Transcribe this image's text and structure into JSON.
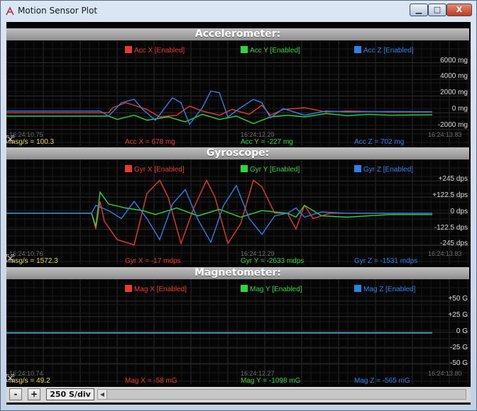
{
  "window": {
    "title": "Motion Sensor Plot",
    "min_label": "▁",
    "max_label": "□",
    "close_label": "X"
  },
  "panels": [
    {
      "key": "acc",
      "title": "Accelerometer:",
      "legend": [
        {
          "label": "Acc X [Enabled]",
          "color": "#e53a2e"
        },
        {
          "label": "Acc Y [Enabled]",
          "color": "#2bd63f"
        },
        {
          "label": "Acc Z [Enabled]",
          "color": "#2f7fe6"
        }
      ],
      "y_ticks": [
        "6000 mg",
        "4000 mg",
        "2000 mg",
        "0 mg",
        "-2000 mg"
      ],
      "y_tick_values": [
        6000,
        4000,
        2000,
        0,
        -2000
      ],
      "y_range": [
        -2200,
        6800
      ],
      "timestamps": [
        "16:24:10.75",
        "16:24:12.29",
        "16:24:13.83"
      ],
      "rate": "msg/s = 100.3",
      "readouts": [
        "Acc X = 678 mg",
        "Acc Y = -227 mg",
        "Acc Z = 702 mg"
      ],
      "series": [
        {
          "name": "Acc X",
          "color": "#e53a2e",
          "points": [
            [
              0,
              0
            ],
            [
              0.24,
              0
            ],
            [
              0.25,
              600
            ],
            [
              0.28,
              1200
            ],
            [
              0.3,
              900
            ],
            [
              0.33,
              400
            ],
            [
              0.36,
              -500
            ],
            [
              0.4,
              -300
            ],
            [
              0.43,
              800
            ],
            [
              0.46,
              200
            ],
            [
              0.5,
              -300
            ],
            [
              0.53,
              400
            ],
            [
              0.57,
              -200
            ],
            [
              0.6,
              900
            ],
            [
              0.62,
              -300
            ],
            [
              0.65,
              400
            ],
            [
              0.7,
              600
            ],
            [
              0.75,
              100
            ],
            [
              0.8,
              200
            ],
            [
              0.85,
              150
            ],
            [
              0.9,
              100
            ],
            [
              1,
              80
            ]
          ]
        },
        {
          "name": "Acc Y",
          "color": "#2bd63f",
          "points": [
            [
              0,
              -400
            ],
            [
              0.24,
              -400
            ],
            [
              0.26,
              -800
            ],
            [
              0.3,
              -300
            ],
            [
              0.33,
              -900
            ],
            [
              0.38,
              -500
            ],
            [
              0.42,
              -1100
            ],
            [
              0.46,
              -200
            ],
            [
              0.5,
              -800
            ],
            [
              0.54,
              -400
            ],
            [
              0.58,
              -1300
            ],
            [
              0.62,
              -500
            ],
            [
              0.66,
              -300
            ],
            [
              0.7,
              -500
            ],
            [
              0.75,
              -100
            ],
            [
              0.8,
              -350
            ],
            [
              0.85,
              -200
            ],
            [
              0.9,
              -300
            ],
            [
              1,
              -250
            ]
          ]
        },
        {
          "name": "Acc Z",
          "color": "#2f7fe6",
          "points": [
            [
              0,
              200
            ],
            [
              0.22,
              200
            ],
            [
              0.24,
              -400
            ],
            [
              0.27,
              1200
            ],
            [
              0.3,
              1600
            ],
            [
              0.32,
              400
            ],
            [
              0.35,
              -900
            ],
            [
              0.39,
              1800
            ],
            [
              0.41,
              1200
            ],
            [
              0.43,
              -1400
            ],
            [
              0.46,
              600
            ],
            [
              0.48,
              2600
            ],
            [
              0.5,
              2400
            ],
            [
              0.52,
              -500
            ],
            [
              0.55,
              600
            ],
            [
              0.58,
              1600
            ],
            [
              0.6,
              1200
            ],
            [
              0.62,
              -600
            ],
            [
              0.65,
              500
            ],
            [
              0.7,
              -300
            ],
            [
              0.75,
              200
            ],
            [
              0.8,
              100
            ],
            [
              0.9,
              150
            ],
            [
              1,
              120
            ]
          ]
        }
      ]
    },
    {
      "key": "gyr",
      "title": "Gyroscope:",
      "legend": [
        {
          "label": "Gyr X [Enabled]",
          "color": "#e53a2e"
        },
        {
          "label": "Gyr Y [Enabled]",
          "color": "#2bd63f"
        },
        {
          "label": "Gyr Z [Enabled]",
          "color": "#2f7fe6"
        }
      ],
      "y_ticks": [
        "+245 dps",
        "+122.5 dps",
        "0 dps",
        "-122.5 dps",
        "-245 dps"
      ],
      "y_tick_values": [
        245,
        122.5,
        0,
        -122.5,
        -245
      ],
      "y_range": [
        -280,
        290
      ],
      "timestamps": [
        "16:24:10.76",
        "16:24:12.29",
        "16:24:13.83"
      ],
      "rate": "msg/s = 1572.3",
      "readouts": [
        "Gyr X = -17 mdps",
        "Gyr Y = -2633 mdps",
        "Gyr Z = -1531 mdps"
      ],
      "series": [
        {
          "name": "Gyr X",
          "color": "#e53a2e",
          "points": [
            [
              0,
              0
            ],
            [
              0.2,
              0
            ],
            [
              0.21,
              -120
            ],
            [
              0.22,
              90
            ],
            [
              0.23,
              -60
            ],
            [
              0.26,
              -200
            ],
            [
              0.3,
              -240
            ],
            [
              0.33,
              150
            ],
            [
              0.36,
              250
            ],
            [
              0.38,
              120
            ],
            [
              0.41,
              -230
            ],
            [
              0.44,
              40
            ],
            [
              0.47,
              250
            ],
            [
              0.49,
              120
            ],
            [
              0.52,
              -230
            ],
            [
              0.55,
              -80
            ],
            [
              0.58,
              250
            ],
            [
              0.6,
              200
            ],
            [
              0.63,
              0
            ],
            [
              0.66,
              0
            ],
            [
              0.68,
              -120
            ],
            [
              0.7,
              60
            ],
            [
              0.72,
              -40
            ],
            [
              0.76,
              0
            ],
            [
              1,
              0
            ]
          ]
        },
        {
          "name": "Gyr Y",
          "color": "#2bd63f",
          "points": [
            [
              0,
              0
            ],
            [
              0.2,
              0
            ],
            [
              0.21,
              -100
            ],
            [
              0.22,
              160
            ],
            [
              0.24,
              70
            ],
            [
              0.28,
              40
            ],
            [
              0.32,
              20
            ],
            [
              0.35,
              -10
            ],
            [
              0.4,
              40
            ],
            [
              0.45,
              -20
            ],
            [
              0.5,
              30
            ],
            [
              0.55,
              -30
            ],
            [
              0.6,
              20
            ],
            [
              0.66,
              0
            ],
            [
              0.68,
              -30
            ],
            [
              0.7,
              60
            ],
            [
              0.74,
              -20
            ],
            [
              0.8,
              -30
            ],
            [
              0.85,
              -20
            ],
            [
              0.9,
              -10
            ],
            [
              1,
              -10
            ]
          ]
        },
        {
          "name": "Gyr Z",
          "color": "#2f7fe6",
          "points": [
            [
              0,
              0
            ],
            [
              0.2,
              0
            ],
            [
              0.21,
              60
            ],
            [
              0.24,
              20
            ],
            [
              0.27,
              -40
            ],
            [
              0.3,
              90
            ],
            [
              0.33,
              -40
            ],
            [
              0.36,
              -200
            ],
            [
              0.39,
              70
            ],
            [
              0.42,
              180
            ],
            [
              0.45,
              -50
            ],
            [
              0.48,
              -220
            ],
            [
              0.51,
              60
            ],
            [
              0.54,
              210
            ],
            [
              0.57,
              -40
            ],
            [
              0.6,
              -160
            ],
            [
              0.63,
              -20
            ],
            [
              0.66,
              0
            ],
            [
              0.68,
              40
            ],
            [
              0.7,
              -30
            ],
            [
              0.74,
              10
            ],
            [
              0.8,
              0
            ],
            [
              1,
              0
            ]
          ]
        }
      ]
    },
    {
      "key": "mag",
      "title": "Magnetometer:",
      "legend": [
        {
          "label": "Mag X [Enabled]",
          "color": "#e53a2e"
        },
        {
          "label": "Mag Y [Enabled]",
          "color": "#2bd63f"
        },
        {
          "label": "Mag Z [Enabled]",
          "color": "#2f7fe6"
        }
      ],
      "y_ticks": [
        "+50 G",
        "+25 G",
        "0 G",
        "-25 G",
        "-50 G"
      ],
      "y_tick_values": [
        50,
        25,
        0,
        -25,
        -50
      ],
      "y_range": [
        -60,
        60
      ],
      "timestamps": [
        "16:24:10.74",
        "16:24:12.27",
        "16:24:13.80"
      ],
      "rate": "msg/s = 49.2",
      "readouts": [
        "Mag X = -58 mG",
        "Mag Y = -1098 mG",
        "Mag Z = -565 mG"
      ],
      "series": [
        {
          "name": "Mag X",
          "color": "#e53a2e",
          "points": [
            [
              0,
              -0.06
            ],
            [
              1,
              -0.06
            ]
          ]
        },
        {
          "name": "Mag Y",
          "color": "#2bd63f",
          "points": [
            [
              0,
              -1.1
            ],
            [
              0.21,
              -1.1
            ],
            [
              0.66,
              -1.1
            ],
            [
              1,
              -1.1
            ]
          ]
        },
        {
          "name": "Mag Z",
          "color": "#2f7fe6",
          "points": [
            [
              0,
              -0.56
            ],
            [
              0.21,
              -0.56
            ],
            [
              0.22,
              -0.7
            ],
            [
              0.66,
              -0.7
            ],
            [
              0.67,
              -0.56
            ],
            [
              1,
              -0.56
            ]
          ]
        }
      ]
    }
  ],
  "bottom": {
    "minus_label": "-",
    "plus_label": "+",
    "rate_label": "250 S/div",
    "scroll_left": "◀"
  }
}
